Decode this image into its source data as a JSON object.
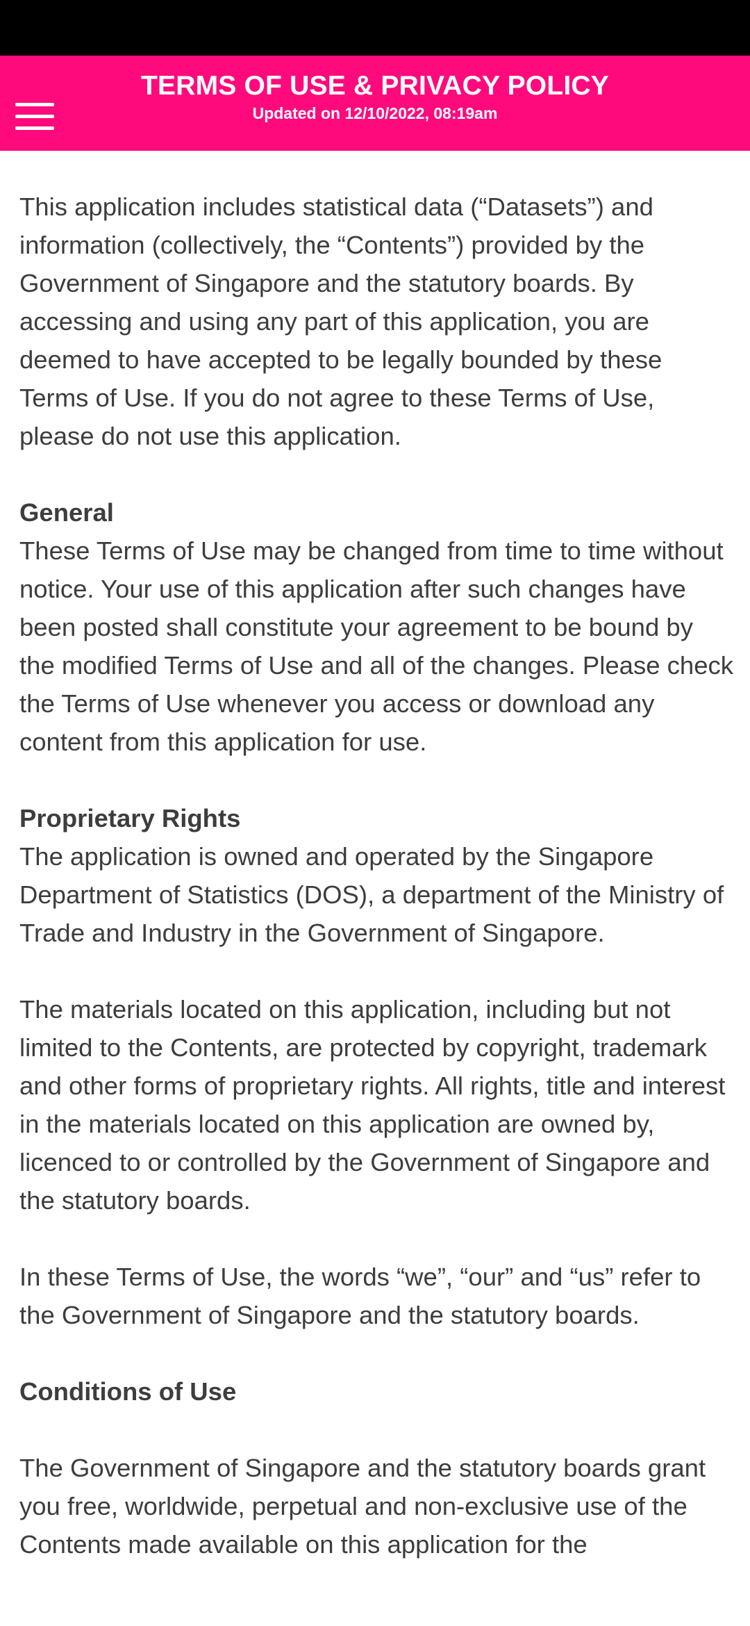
{
  "header": {
    "title": "TERMS OF USE & PRIVACY POLICY",
    "subtitle": "Updated on 12/10/2022, 08:19am",
    "menu_icon": "hamburger-menu-icon",
    "background_color": "#ff0a7d"
  },
  "content": {
    "intro": "This application includes statistical data (“Datasets”) and information (collectively, the “Contents”) provided by the Government of Singapore and the statutory boards. By accessing and using any part of this application, you are deemed to have accepted to be legally bounded by these Terms of Use. If you do not agree to these Terms of Use, please do not use this application.",
    "general_heading": "General",
    "general_text": "These Terms of Use may be changed from time to time without notice. Your use of this application after such changes have been posted shall constitute your agreement to be bound by the modified Terms of Use and all of the changes. Please check the Terms of Use whenever you access or download any content from this application for use.",
    "proprietary_heading": "Proprietary Rights",
    "proprietary_text_1": "The application is owned and operated by the Singapore Department of Statistics (DOS), a department of the Ministry of Trade and Industry in the Government of Singapore.",
    "proprietary_text_2": "The materials located on this application, including but not limited to the Contents, are protected by copyright, trademark and other forms of proprietary rights. All rights, title and interest in the materials located on this application are owned by, licenced to or controlled by the Government of Singapore and the statutory boards.",
    "proprietary_text_3": "In these Terms of Use, the words “we”, “our” and “us” refer to the Government of Singapore and the statutory boards.",
    "conditions_heading": "Conditions of Use",
    "conditions_text": "The Government of Singapore and the statutory boards grant you free, worldwide, perpetual and non-exclusive use of the Contents made available on this application for the"
  }
}
